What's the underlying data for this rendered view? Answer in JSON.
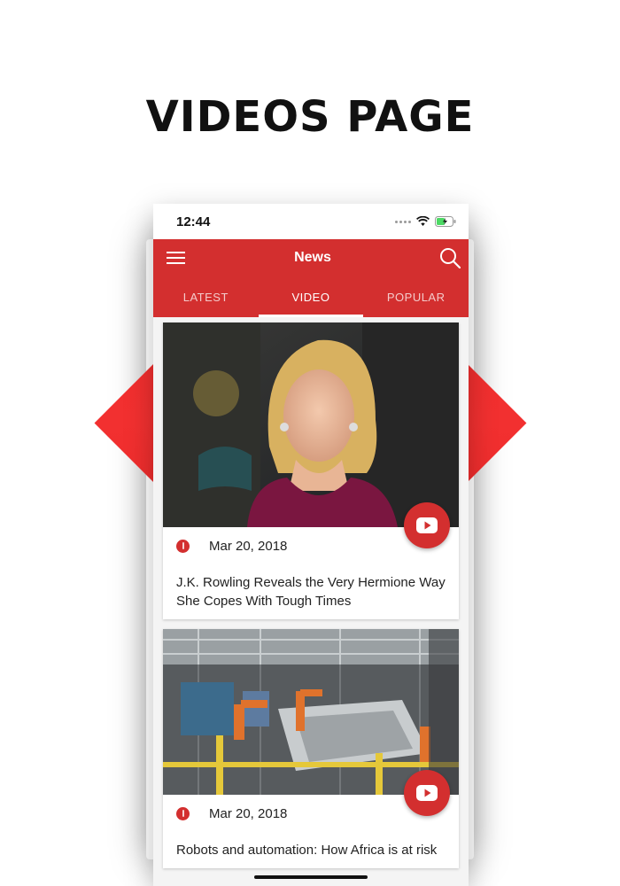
{
  "heading": "VIDEOS PAGE",
  "status": {
    "time": "12:44"
  },
  "app_bar": {
    "title": "News"
  },
  "tabs": [
    {
      "label": "LATEST",
      "active": false
    },
    {
      "label": "VIDEO",
      "active": true
    },
    {
      "label": "POPULAR",
      "active": false
    }
  ],
  "articles": [
    {
      "date": "Mar 20, 2018",
      "title": "J.K. Rowling Reveals the Very Hermione Way She Copes With Tough Times"
    },
    {
      "date": "Mar 20, 2018",
      "title": "Robots and automation: How Africa is at risk"
    }
  ],
  "colors": {
    "accent": "#d32f2f",
    "background_diamond": "#ef2b2b"
  }
}
